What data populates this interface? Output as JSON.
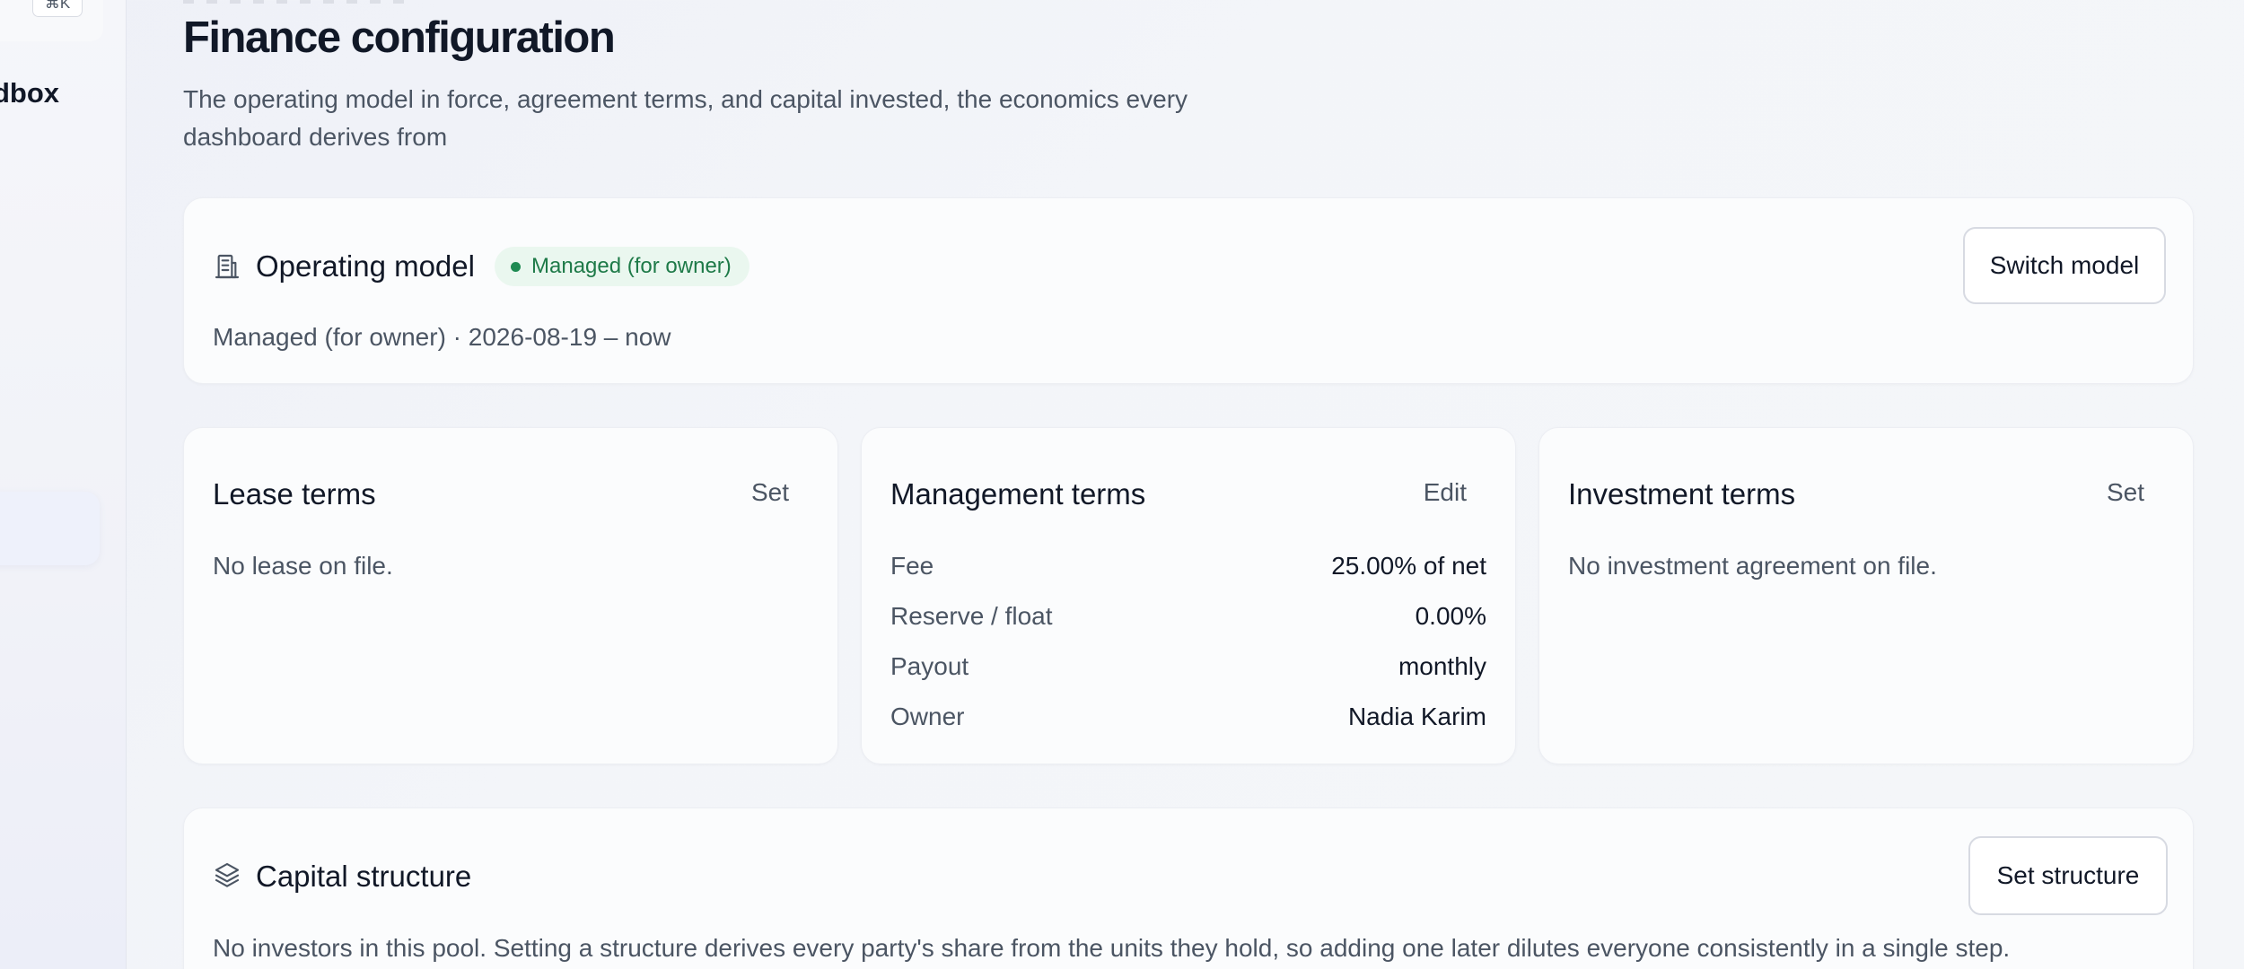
{
  "sidebar": {
    "shortcut_hint": "⌘K",
    "workspace_name": "dbox"
  },
  "header": {
    "title": "Finance configuration",
    "subtitle": "The operating model in force, agreement terms, and capital invested, the economics every dashboard derives from"
  },
  "operating_model": {
    "icon": "building-icon",
    "title": "Operating model",
    "badge": "Managed (for owner)",
    "badge_color": "#1e8a52",
    "period": "Managed (for owner) · 2026-08-19 – now",
    "action_label": "Switch model"
  },
  "lease_terms": {
    "title": "Lease terms",
    "action_label": "Set",
    "empty_text": "No lease on file."
  },
  "management_terms": {
    "title": "Management terms",
    "action_label": "Edit",
    "rows": [
      {
        "label": "Fee",
        "value": "25.00% of net"
      },
      {
        "label": "Reserve / float",
        "value": "0.00%"
      },
      {
        "label": "Payout",
        "value": "monthly"
      },
      {
        "label": "Owner",
        "value": "Nadia Karim"
      }
    ]
  },
  "investment_terms": {
    "title": "Investment terms",
    "action_label": "Set",
    "empty_text": "No investment agreement on file."
  },
  "capital_structure": {
    "icon": "layers-icon",
    "title": "Capital structure",
    "action_label": "Set structure",
    "description": "No investors in this pool. Setting a structure derives every party's share from the units they hold, so adding one later dilutes everyone consistently in a single step."
  }
}
